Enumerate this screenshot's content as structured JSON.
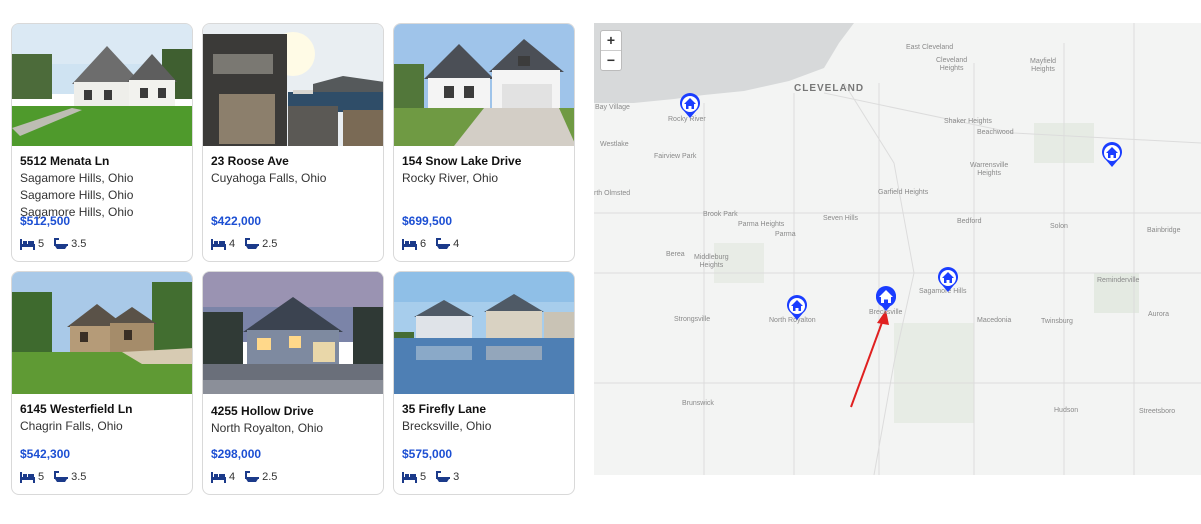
{
  "listings": [
    {
      "address": "5512 Menata Ln",
      "city": "Sagamore Hills, Ohio Sagamore Hills, Ohio Sagamore Hills, Ohio",
      "price": "$512,500",
      "beds": "5",
      "baths": "3.5"
    },
    {
      "address": "23 Roose Ave",
      "city": "Cuyahoga Falls, Ohio",
      "price": "$422,000",
      "beds": "4",
      "baths": "2.5"
    },
    {
      "address": "154 Snow Lake Drive",
      "city": "Rocky River, Ohio",
      "price": "$699,500",
      "beds": "6",
      "baths": "4"
    },
    {
      "address": "6145 Westerfield Ln",
      "city": "Chagrin Falls, Ohio",
      "price": "$542,300",
      "beds": "5",
      "baths": "3.5"
    },
    {
      "address": "4255 Hollow Drive",
      "city": "North Royalton, Ohio",
      "price": "$298,000",
      "beds": "4",
      "baths": "2.5"
    },
    {
      "address": "35 Firefly Lane",
      "city": "Brecksville, Ohio",
      "price": "$575,000",
      "beds": "5",
      "baths": "3"
    }
  ],
  "map": {
    "zoom_in": "+",
    "zoom_out": "−",
    "labels": {
      "cleveland": "CLEVELAND",
      "east_cleveland": "East Cleveland",
      "cleveland_heights": "Cleveland\nHeights",
      "mayfield_heights": "Mayfield\nHeights",
      "bay_village": "Bay Village",
      "rocky_river": "Rocky River",
      "westlake": "Westlake",
      "fairview_park": "Fairview Park",
      "shaker_heights": "Shaker Heights",
      "beachwood": "Beachwood",
      "warrensville_heights": "Warrensville\nHeights",
      "north_olmsted": "rth Olmsted",
      "garfield_heights": "Garfield Heights",
      "brook_park": "Brook Park",
      "seven_hills": "Seven Hills",
      "parma_heights": "Parma Heights",
      "parma": "Parma",
      "bedford": "Bedford",
      "solon": "Solon",
      "bainbridge": "Bainbridge",
      "berea": "Berea",
      "middleburg_heights": "Middleburg\nHeights",
      "sagamore_hills": "Sagamore Hills",
      "reminderville": "Reminderville",
      "strongsville": "Strongsville",
      "north_royalton": "North Royalton",
      "brecksville": "Brecksville",
      "macedonia": "Macedonia",
      "twinsburg": "Twinsburg",
      "aurora": "Aurora",
      "brunswick": "Brunswick",
      "hudson": "Hudson",
      "streetsboro": "Streetsboro"
    },
    "pin_color": "#1a3dff",
    "arrow_color": "#e02020"
  }
}
